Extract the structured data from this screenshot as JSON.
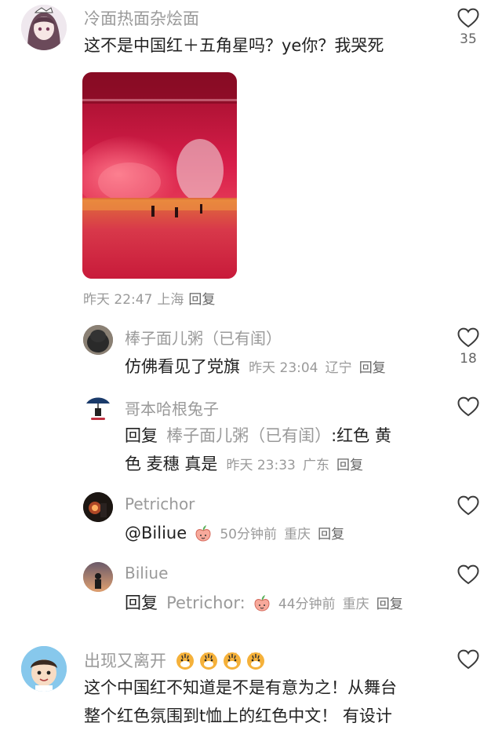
{
  "comments": [
    {
      "user": "冷面热面杂烩面",
      "text": "这不是中国红＋五角星吗？ye你？我哭死",
      "time": "昨天 22:47",
      "location": "上海",
      "reply_label": "回复",
      "likes": "35",
      "replies": [
        {
          "user": "棒子面儿粥（已有闺）",
          "text": "仿佛看见了党旗",
          "time": "昨天 23:04",
          "location": "辽宁",
          "reply_label": "回复",
          "likes": "18"
        },
        {
          "user": "哥本哈根兔子",
          "reply_prefix": "回复",
          "quoted_user": "棒子面儿粥（已有闺）",
          "text_line1": ":红色 黄",
          "text_line2": "色 麦穗  真是",
          "time": "昨天 23:33",
          "location": "广东",
          "reply_label": "回复"
        },
        {
          "user": "Petrichor",
          "text": "@Biliue",
          "time": "50分钟前",
          "location": "重庆",
          "reply_label": "回复"
        },
        {
          "user": "Biliue",
          "reply_prefix": "回复",
          "quoted_user": "Petrichor:",
          "time": "44分钟前",
          "location": "重庆",
          "reply_label": "回复"
        }
      ]
    },
    {
      "user": "出现又离开",
      "text_line1": "这个中国红不知道是不是有意为之！从舞台",
      "text_line2": "整个红色氛围到t恤上的红色中文！ 有设计"
    }
  ],
  "colors": {
    "background": "#ffffff",
    "username": "#9a9a9a",
    "text": "#222222",
    "meta": "#9a9a9a",
    "heart_outline": "#3a3a3a"
  },
  "icons": [
    "heart-outline-icon",
    "peach-emoji-icon",
    "tiger-emoji-icon"
  ]
}
